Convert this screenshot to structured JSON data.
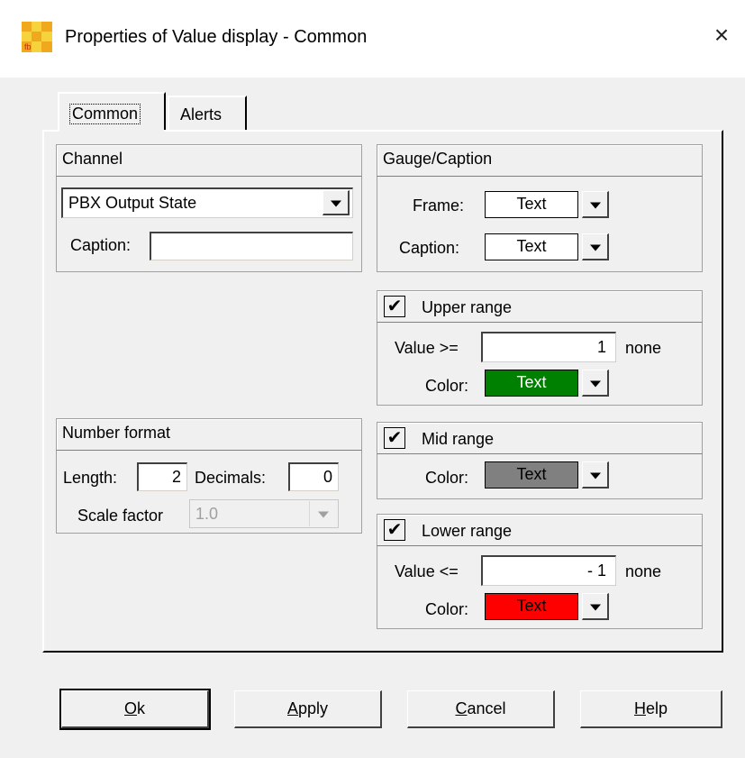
{
  "window": {
    "title": "Properties of Value display - Common",
    "icon": "app-icon",
    "close": "×"
  },
  "tabs": [
    {
      "label": "Common",
      "active": true
    },
    {
      "label": "Alerts",
      "active": false
    }
  ],
  "channel": {
    "header": "Channel",
    "selected": "PBX Output State",
    "caption_label": "Caption:",
    "caption_value": ""
  },
  "number_format": {
    "header": "Number format",
    "length_label": "Length:",
    "length_value": "2",
    "decimals_label": "Decimals:",
    "decimals_value": "0",
    "scale_label": "Scale factor",
    "scale_value": "1.0"
  },
  "gauge": {
    "header": "Gauge/Caption",
    "frame_label": "Frame:",
    "frame_value": "Text",
    "caption_label": "Caption:",
    "caption_value": "Text"
  },
  "upper": {
    "header": "Upper range",
    "checked": "✔",
    "value_label": "Value >=",
    "value": "1",
    "unit": "none",
    "color_label": "Color:",
    "color_text": "Text",
    "color": "#008000"
  },
  "mid": {
    "header": "Mid range",
    "checked": "✔",
    "color_label": "Color:",
    "color_text": "Text",
    "color": "#808080"
  },
  "lower": {
    "header": "Lower range",
    "checked": "✔",
    "value_label": "Value <=",
    "value": "- 1",
    "unit": "none",
    "color_label": "Color:",
    "color_text": "Text",
    "color": "#ff0000"
  },
  "buttons": {
    "ok_u": "O",
    "ok_rest": "k",
    "apply_u": "A",
    "apply_rest": "pply",
    "cancel_u": "C",
    "cancel_rest": "ancel",
    "help_u": "H",
    "help_rest": "elp"
  }
}
